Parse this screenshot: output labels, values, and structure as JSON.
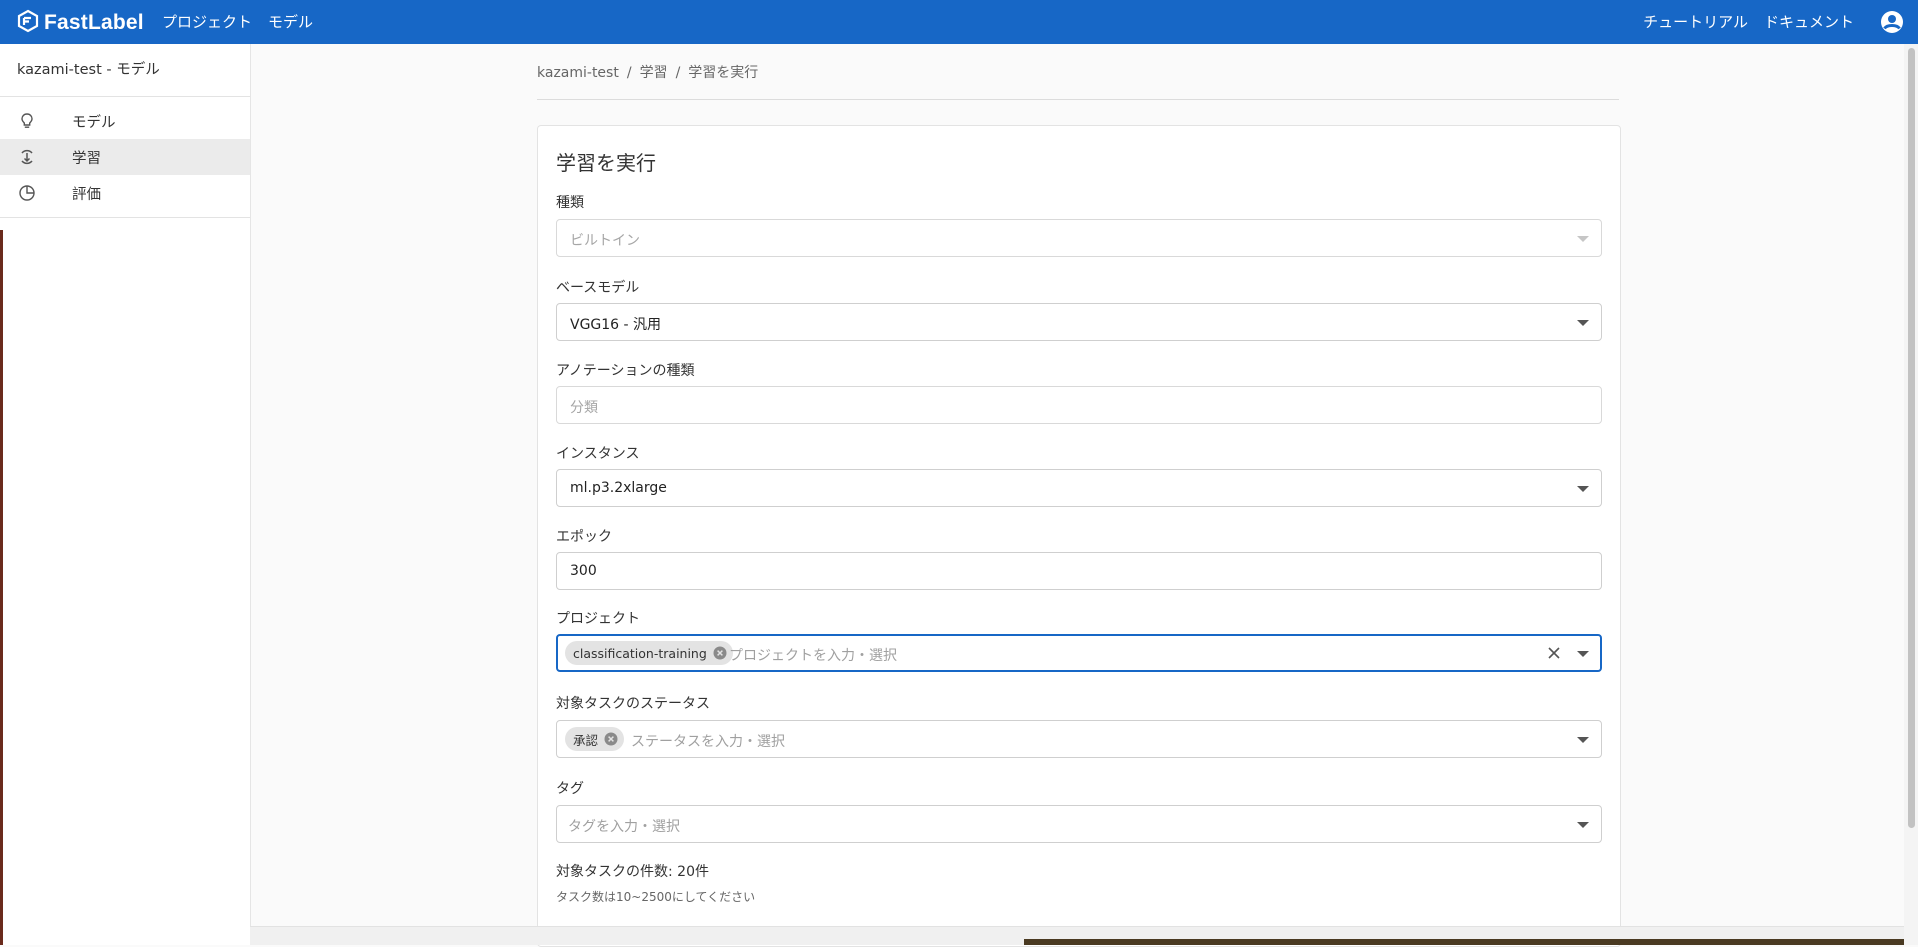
{
  "header": {
    "brand": "FastLabel",
    "nav_left": [
      "プロジェクト",
      "モデル"
    ],
    "nav_right": [
      "チュートリアル",
      "ドキュメント"
    ],
    "brand_color": "#1767c6"
  },
  "sidebar": {
    "title": "kazami-test - モデル",
    "items": [
      {
        "label": "モデル",
        "icon": "lightbulb-icon"
      },
      {
        "label": "学習",
        "icon": "training-icon"
      },
      {
        "label": "評価",
        "icon": "chart-pie-icon"
      }
    ],
    "active_index": 1
  },
  "breadcrumb": [
    "kazami-test",
    "学習",
    "学習を実行"
  ],
  "form": {
    "title": "学習を実行",
    "type": {
      "label": "種類",
      "value": "ビルトイン"
    },
    "base_model": {
      "label": "ベースモデル",
      "value": "VGG16 - 汎用"
    },
    "annotation_type": {
      "label": "アノテーションの種類",
      "value": "分類"
    },
    "instance": {
      "label": "インスタンス",
      "value": "ml.p3.2xlarge"
    },
    "epoch": {
      "label": "エポック",
      "value": "300"
    },
    "project": {
      "label": "プロジェクト",
      "chip": "classification-training",
      "placeholder": "プロジェクトを入力・選択"
    },
    "status": {
      "label": "対象タスクのステータス",
      "chip": "承認",
      "placeholder": "ステータスを入力・選択"
    },
    "tag": {
      "label": "タグ",
      "placeholder": "タグを入力・選択"
    },
    "task_count": "対象タスクの件数: 20件",
    "task_hint": "タスク数は10~2500にしてください"
  }
}
